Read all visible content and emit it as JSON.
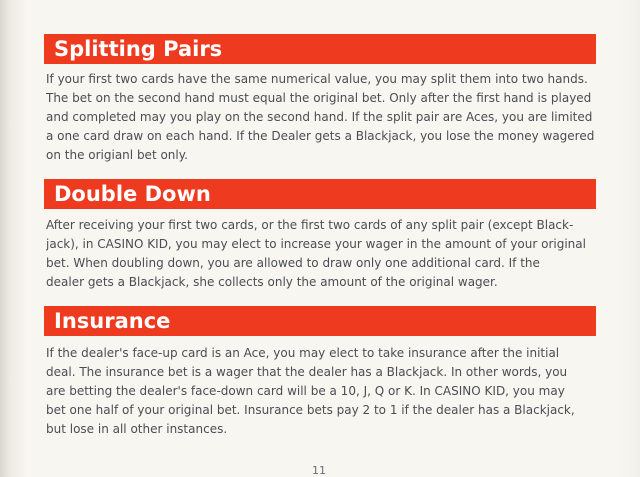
{
  "sections": [
    {
      "heading": "Splitting Pairs",
      "lines": [
        "If your first two cards have the same numerical value, you may split them into two hands.",
        "The bet on the second hand must equal the original bet. Only after the first hand is played",
        "and completed may you play on the second hand. If the split pair are Aces, you are limited to",
        "a one card draw on each hand. If the Dealer gets a Blackjack, you lose the money wagered",
        "on the origianl bet only."
      ]
    },
    {
      "heading": "Double Down",
      "lines": [
        "After receiving your first two cards, or the first two cards of any split pair (except Black-",
        "jack), in CASINO KID, you may elect to increase your wager in the amount of your original",
        "bet. When doubling down, you are allowed to draw only one additional card. If the",
        "dealer gets a Blackjack, she collects only the amount of the original wager."
      ]
    },
    {
      "heading": "Insurance",
      "lines": [
        "If the dealer's face-up card is an Ace, you may elect to take insurance after the initial",
        "deal. The insurance bet is a wager that the dealer has a Blackjack. In other words, you",
        "are betting the dealer's face-down card will be a 10, J, Q or K. In CASINO KID, you may",
        "bet one half of your original bet. Insurance bets pay 2 to 1 if the dealer has a Blackjack,",
        "but lose in all other instances."
      ]
    }
  ],
  "page_number": "11",
  "colors": {
    "header_background": "#ee3b1f",
    "header_text": "#ffffff",
    "body_text": "#4a4d52",
    "page_background": "#f6f4ef"
  }
}
